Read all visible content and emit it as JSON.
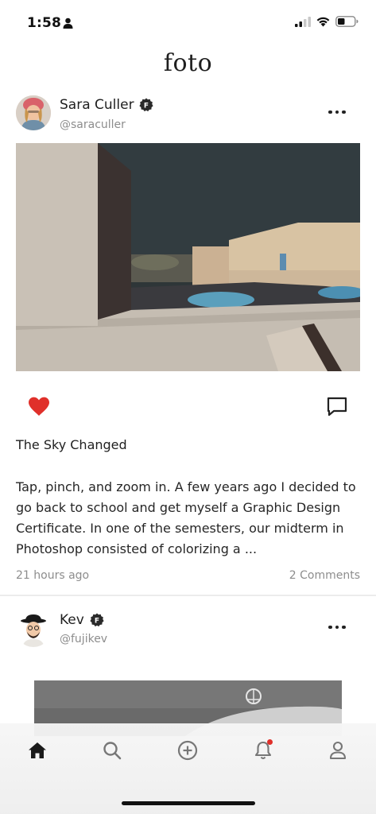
{
  "status_bar": {
    "time": "1:58",
    "icons": [
      "person-icon",
      "cellular-signal-icon",
      "wifi-icon",
      "battery-icon"
    ]
  },
  "header": {
    "app_title": "foto"
  },
  "posts": [
    {
      "author_name": "Sara Culler",
      "handle": "@saraculler",
      "verified_badge": "F",
      "liked": true,
      "title": "The Sky Changed",
      "body": "Tap, pinch, and zoom in. A few years ago I decided to go back to school and get myself a Graphic Design Certificate. In one of the semesters, our midterm in Photoshop consisted of colorizing a ...",
      "time": "21 hours ago",
      "comments": "2 Comments"
    },
    {
      "author_name": "Kev",
      "handle": "@fujikev",
      "verified_badge": "F"
    }
  ],
  "tab_bar": {
    "tabs": [
      "home-icon",
      "search-icon",
      "add-icon",
      "notifications-icon",
      "profile-icon"
    ],
    "active": "home-icon",
    "notification_dot": true
  },
  "colors": {
    "like": "#e0302a",
    "muted_text": "#8d8d8d",
    "notification_dot": "#e0302a"
  }
}
